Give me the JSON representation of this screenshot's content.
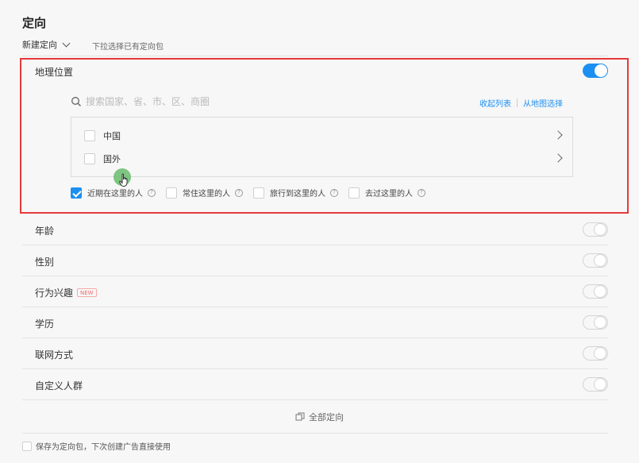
{
  "header": {
    "title": "定向",
    "new_targeting_label": "新建定向",
    "hint": "下拉选择已有定向包"
  },
  "geo": {
    "title": "地理位置",
    "enabled": true,
    "search_placeholder": "搜索国家、省、市、区、商圈",
    "collapse_link": "收起列表",
    "map_link": "从地图选择",
    "regions": [
      {
        "label": "中国",
        "checked": false
      },
      {
        "label": "国外",
        "checked": false
      }
    ],
    "people_options": [
      {
        "label": "近期在这里的人",
        "checked": true
      },
      {
        "label": "常住这里的人",
        "checked": false
      },
      {
        "label": "旅行到这里的人",
        "checked": false
      },
      {
        "label": "去过这里的人",
        "checked": false
      }
    ]
  },
  "rows": [
    {
      "label": "年龄",
      "enabled": false
    },
    {
      "label": "性别",
      "enabled": false
    },
    {
      "label": "行为兴趣",
      "enabled": false,
      "badge": "NEW"
    },
    {
      "label": "学历",
      "enabled": false
    },
    {
      "label": "联网方式",
      "enabled": false
    },
    {
      "label": "自定义人群",
      "enabled": false
    }
  ],
  "footer": {
    "all_targeting_label": "全部定向",
    "save_label": "保存为定向包，下次创建广告直接使用"
  },
  "colors": {
    "accent": "#1e8ff2",
    "highlight": "#e5393a",
    "badge": "#f26b6b"
  }
}
